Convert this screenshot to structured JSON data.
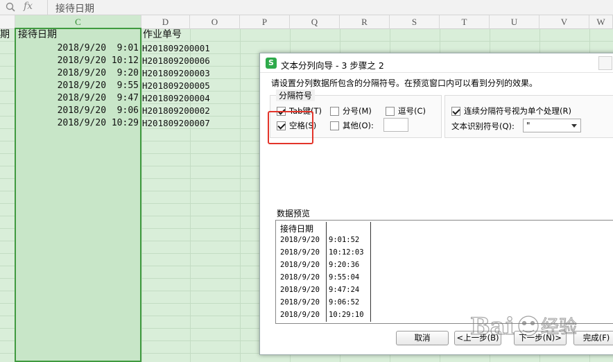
{
  "formula_bar": {
    "fx_label": "fx",
    "content": "接待日期"
  },
  "columns": [
    {
      "letter": ""
    },
    {
      "letter": "C"
    },
    {
      "letter": "D"
    },
    {
      "letter": "O"
    },
    {
      "letter": "P"
    },
    {
      "letter": "Q"
    },
    {
      "letter": "R"
    },
    {
      "letter": "S"
    },
    {
      "letter": "T"
    },
    {
      "letter": "U"
    },
    {
      "letter": "V"
    },
    {
      "letter": "W"
    }
  ],
  "sheet": {
    "partial_header": "期",
    "col_c_header": "接待日期",
    "col_d_header": "作业单号",
    "rows": [
      {
        "date": "2018/9/20  9:01",
        "id": "H201809200001"
      },
      {
        "date": "2018/9/20 10:12",
        "id": "H201809200006"
      },
      {
        "date": "2018/9/20  9:20",
        "id": "H201809200003"
      },
      {
        "date": "2018/9/20  9:55",
        "id": "H201809200005"
      },
      {
        "date": "2018/9/20  9:47",
        "id": "H201809200004"
      },
      {
        "date": "2018/9/20  9:06",
        "id": "H201809200002"
      },
      {
        "date": "2018/9/20 10:29",
        "id": "H201809200007"
      }
    ]
  },
  "dialog": {
    "icon_letter": "S",
    "title": "文本分列向导 - 3 步骤之 2",
    "instruction": "请设置分列数据所包含的分隔符号。在预览窗口内可以看到分列的效果。",
    "delimiter_group_title": "分隔符号",
    "delimiters": {
      "tab": {
        "label": "Tab键(T)",
        "checked": true
      },
      "semicolon": {
        "label": "分号(M)",
        "checked": false
      },
      "comma": {
        "label": "逗号(C)",
        "checked": false
      },
      "space": {
        "label": "空格(S)",
        "checked": true
      },
      "other": {
        "label": "其他(O):",
        "checked": false,
        "value": ""
      }
    },
    "consecutive": {
      "label": "连续分隔符号视为单个处理(R)",
      "checked": true
    },
    "qualifier": {
      "label": "文本识别符号(Q):",
      "value": "\""
    },
    "preview_label": "数据预览",
    "preview": {
      "header": "接待日期",
      "rows": [
        {
          "c1": "2018/9/20",
          "c2": "9:01:52"
        },
        {
          "c1": "2018/9/20",
          "c2": "10:12:03"
        },
        {
          "c1": "2018/9/20",
          "c2": "9:20:36"
        },
        {
          "c1": "2018/9/20",
          "c2": "9:55:04"
        },
        {
          "c1": "2018/9/20",
          "c2": "9:47:24"
        },
        {
          "c1": "2018/9/20",
          "c2": "9:06:52"
        },
        {
          "c1": "2018/9/20",
          "c2": "10:29:10"
        }
      ]
    },
    "buttons": {
      "cancel": "取消",
      "back": "<上一步(B)",
      "next": "下一步(N)>",
      "finish": "完成(F)"
    }
  },
  "colors": {
    "grid_bg": "#d9eed9",
    "selected_col": "#c8e6c8",
    "selection_border": "#3f9a3f",
    "highlight_red": "#e3342a",
    "wps_green": "#2eaa4b"
  },
  "watermark": {
    "text": "Bai百度经验"
  }
}
